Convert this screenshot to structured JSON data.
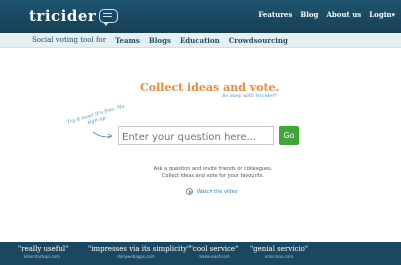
{
  "header": {
    "logo_text": "tricider",
    "nav": [
      "Features",
      "Blog",
      "About us",
      "Login"
    ],
    "login_caret": "▾",
    "brand_color": "#1f5570"
  },
  "subheader": {
    "intro": "Social voting tool for",
    "links": [
      "Teams",
      "Blogs",
      "Education",
      "Crowdsourcing"
    ]
  },
  "hero": {
    "headline": "Collect ideas and vote.",
    "tagline": "So easy with tricider!",
    "handwritten_note": "Try it now! It's free. No sign up.",
    "question_placeholder": "Enter your question here...",
    "go_label": "Go",
    "go_color": "#3fa63a",
    "explain_line1": "Ask a question and invite friends or colleagues.",
    "explain_line2": "Collect ideas and vote for your favourits.",
    "video_label": "Watch the video"
  },
  "footer": {
    "quotes": [
      {
        "text": "\"really useful\"",
        "source": "killerstartups.com"
      },
      {
        "text": "\"impresses via its simplicity\"",
        "source": "dailywebapps.com"
      },
      {
        "text": "\"cool service\"",
        "source": "makeuseof.com"
      },
      {
        "text": "\"genial servicio\"",
        "source": "omicrono.com"
      }
    ]
  }
}
